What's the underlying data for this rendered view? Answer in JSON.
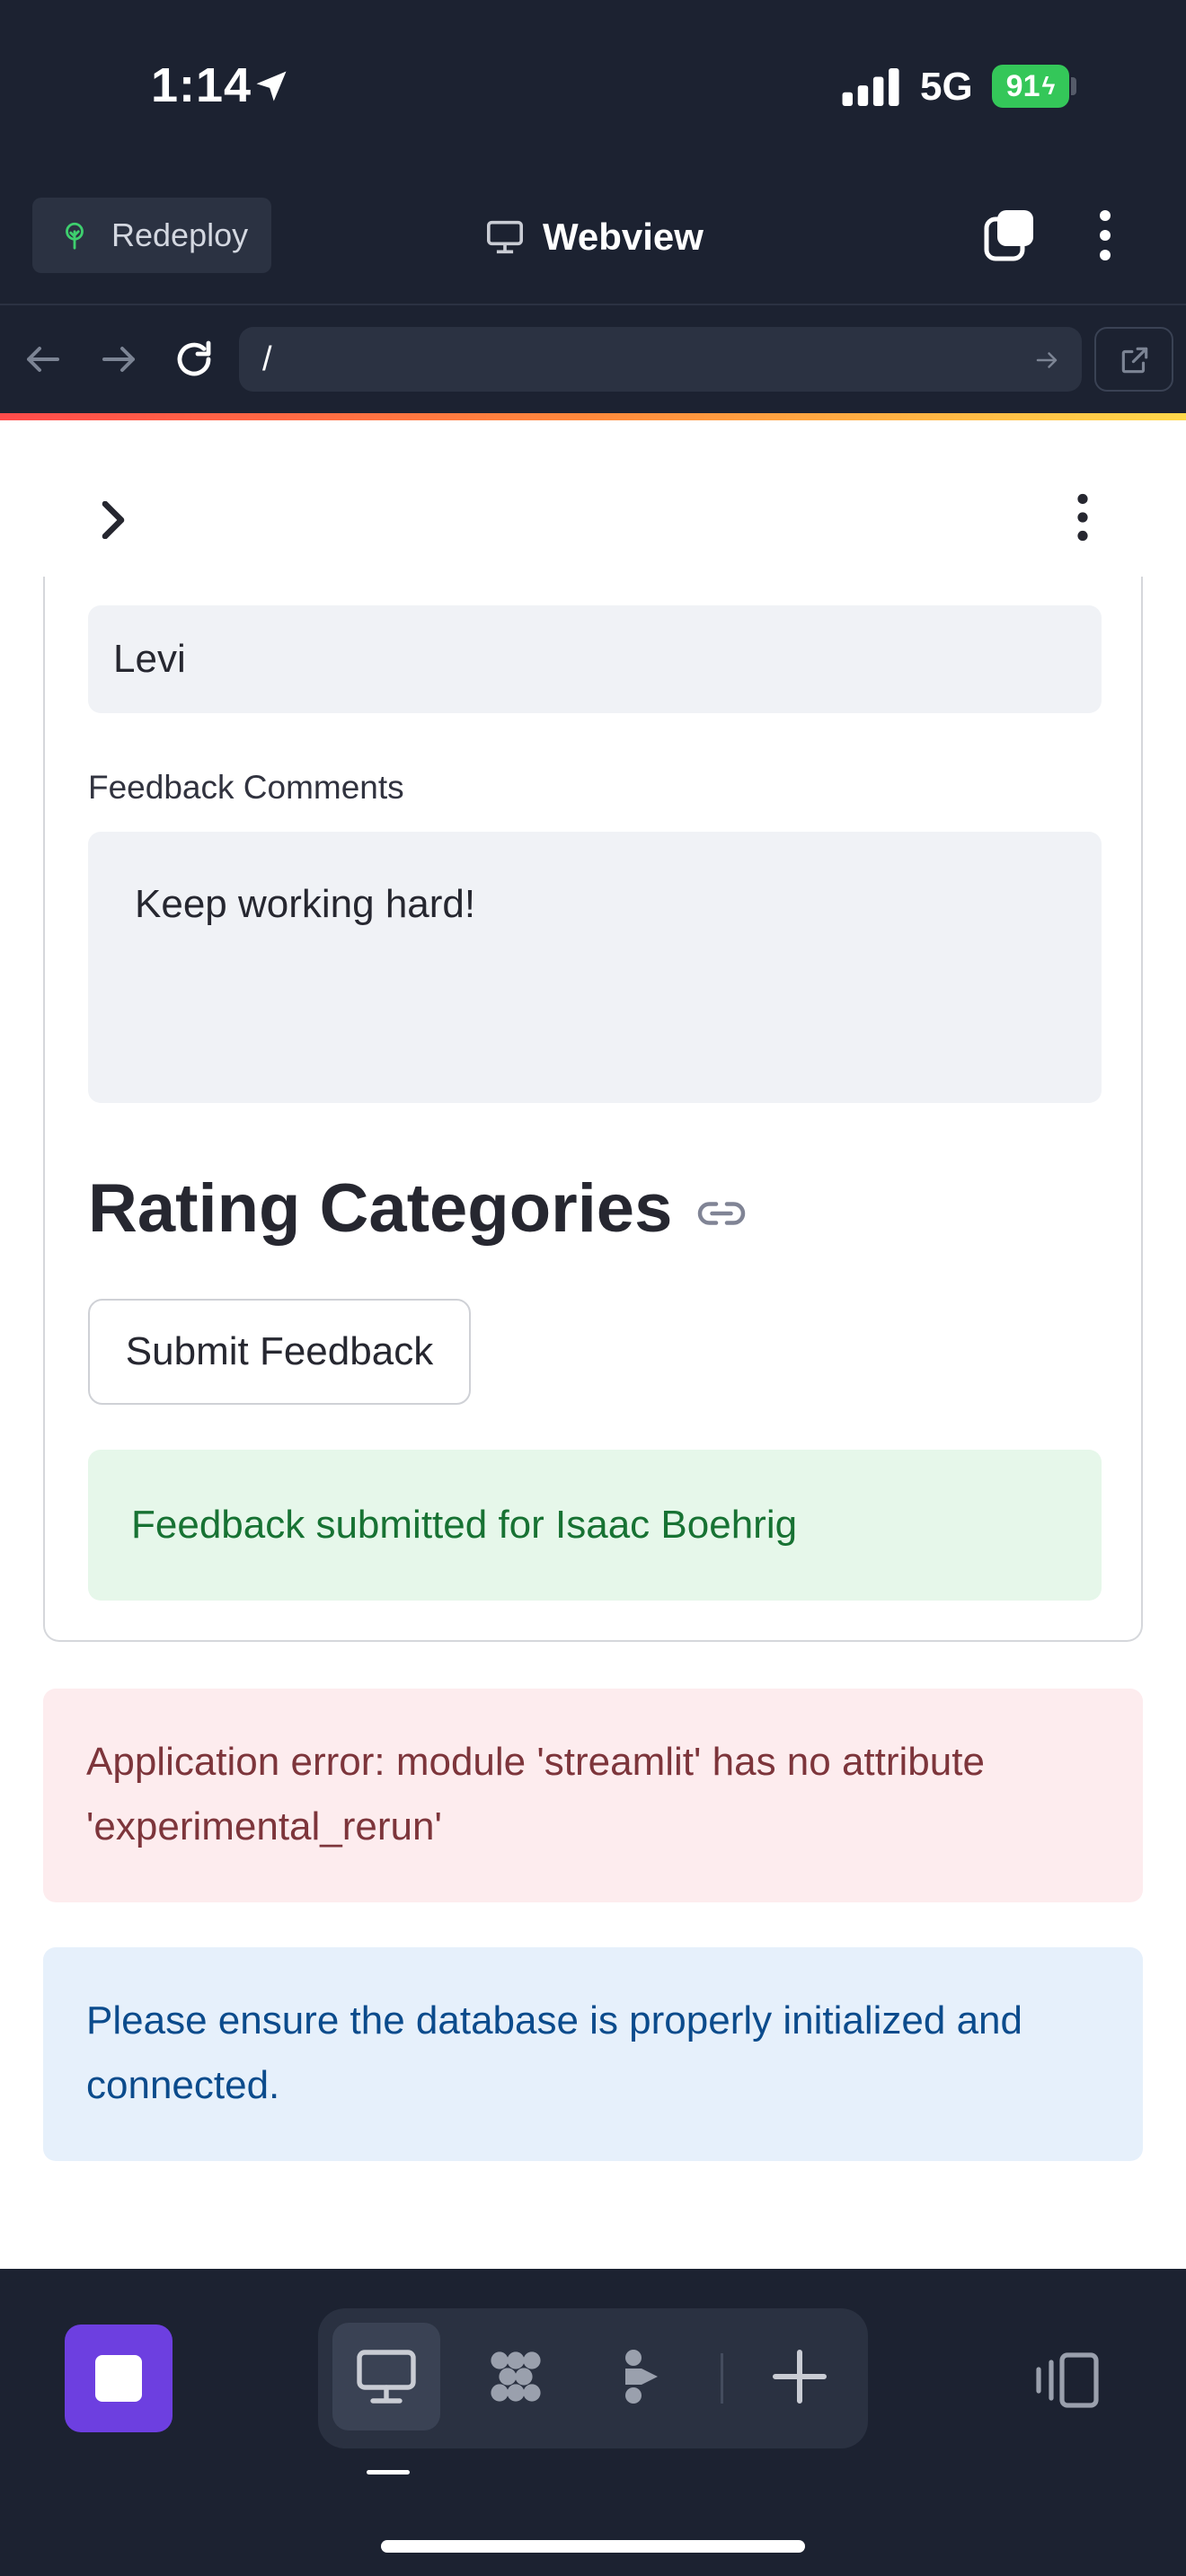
{
  "status_bar": {
    "time": "1:14",
    "network": "5G",
    "battery": "91"
  },
  "topbar": {
    "redeploy_label": "Redeploy",
    "title": "Webview"
  },
  "urlbar": {
    "url": "/"
  },
  "form": {
    "name_value": "Levi",
    "feedback_label": "Feedback Comments",
    "feedback_value": "Keep working hard!",
    "section_heading": "Rating Categories",
    "submit_label": "Submit Feedback",
    "success_message": "Feedback submitted for Isaac Boehrig"
  },
  "alerts": {
    "error_line1": "Application error: module 'streamlit' has no attribute",
    "error_line2": "'experimental_rerun'",
    "info_line1": "Please ensure the database is properly initialized and",
    "info_line2": "connected."
  },
  "colors": {
    "accent": "#6d3fe0",
    "success_text": "#177233",
    "error_text": "#7d353b",
    "info_text": "#0b4b8c"
  },
  "icons": [
    "location-arrow-icon",
    "signal-icon",
    "battery-icon",
    "tree-icon",
    "monitor-icon",
    "tabs-icon",
    "more-vertical-icon",
    "back-icon",
    "forward-icon",
    "reload-icon",
    "go-arrow-icon",
    "external-link-icon",
    "chevron-right-icon",
    "link-icon",
    "stop-icon",
    "workflow-icon",
    "agent-icon",
    "plus-icon",
    "panel-icon"
  ]
}
